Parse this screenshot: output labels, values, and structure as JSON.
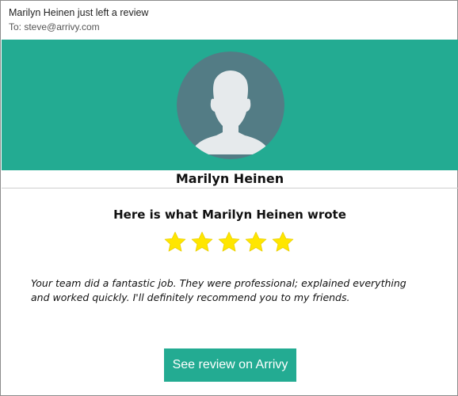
{
  "email": {
    "subject": "Marilyn Heinen just left a review",
    "to_line": "To: steve@arrivy.com"
  },
  "reviewer": {
    "name": "Marilyn Heinen",
    "heading": "Here is what Marilyn Heinen wrote",
    "rating": 5,
    "rating_max": 5,
    "review_text": "Your team did a fantastic job. They were professional; explained everything and worked quickly. I'll definitely recommend you to my friends."
  },
  "cta": {
    "label": "See review on Arrivy"
  },
  "colors": {
    "brand": "#23ab92",
    "avatar_bg": "#537c85",
    "avatar_figure": "#e6eaec",
    "star": "#ffe600",
    "star_outline": "#e9cf00"
  },
  "icons": {
    "avatar": "user-silhouette-icon",
    "star": "star-icon"
  }
}
